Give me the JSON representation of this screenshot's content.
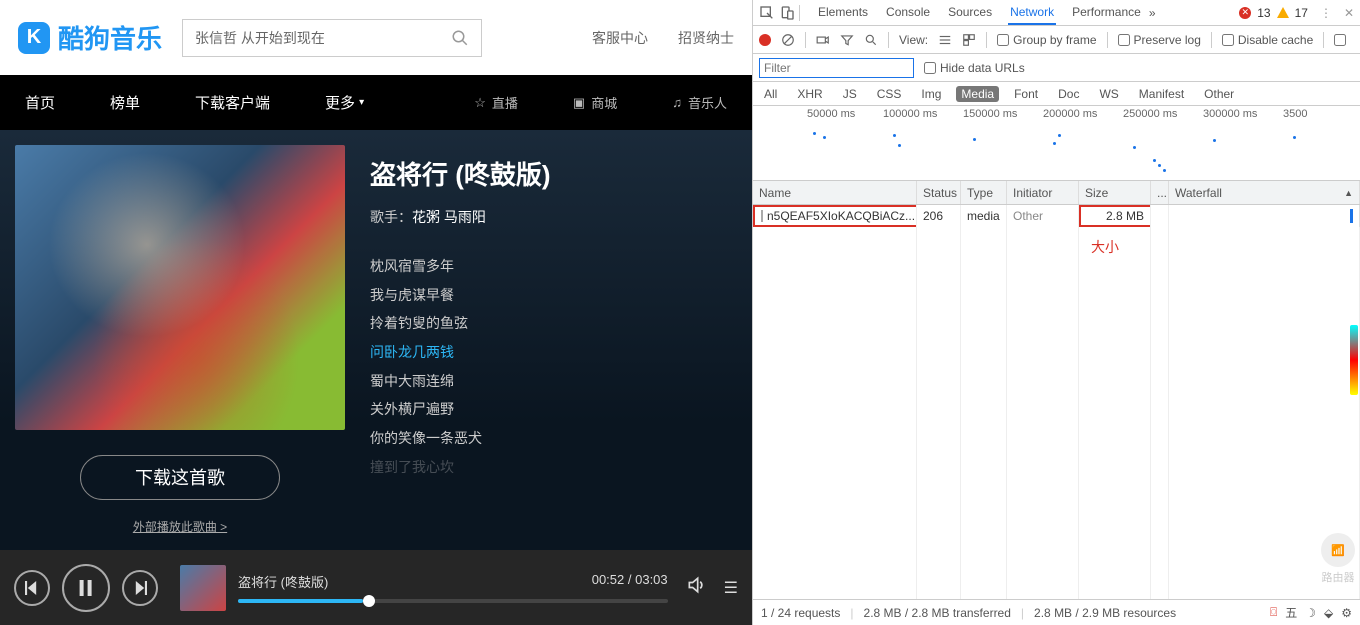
{
  "site": {
    "name": "酷狗音乐",
    "search_value": "张信哲 从开始到现在",
    "header_links": [
      "客服中心",
      "招贤纳士"
    ]
  },
  "nav": {
    "items": [
      "首页",
      "榜单",
      "下载客户端",
      "更多"
    ],
    "right": [
      {
        "icon": "star",
        "label": "直播"
      },
      {
        "icon": "cart",
        "label": "商城"
      },
      {
        "icon": "headphone",
        "label": "音乐人"
      }
    ]
  },
  "song": {
    "title": "盗将行 (咚鼓版)",
    "artist_label": "歌手：",
    "artist": "花粥 马雨阳",
    "lyrics": [
      "枕风宿雪多年",
      "我与虎谋早餐",
      "拎着钓叟的鱼弦",
      "问卧龙几两钱",
      "蜀中大雨连绵",
      "关外横尸遍野",
      "你的笑像一条恶犬",
      "撞到了我心坎"
    ],
    "active_lyric_index": 3,
    "download_btn": "下载这首歌",
    "external_link": "外部播放此歌曲 >"
  },
  "player": {
    "track": "盗将行 (咚鼓版)",
    "elapsed": "00:52",
    "duration": "03:03"
  },
  "devtools": {
    "tabs": [
      "Elements",
      "Console",
      "Sources",
      "Network",
      "Performance"
    ],
    "active_tab": "Network",
    "more": "»",
    "errors": "13",
    "warnings": "17",
    "toolbar": {
      "view_label": "View:",
      "group": "Group by frame",
      "preserve": "Preserve log",
      "disable_cache": "Disable cache"
    },
    "filter_placeholder": "Filter",
    "hide_data": "Hide data URLs",
    "type_filters": [
      "All",
      "XHR",
      "JS",
      "CSS",
      "Img",
      "Media",
      "Font",
      "Doc",
      "WS",
      "Manifest",
      "Other"
    ],
    "active_type_filter": "Media",
    "timeline_ticks": [
      "50000 ms",
      "100000 ms",
      "150000 ms",
      "200000 ms",
      "250000 ms",
      "300000 ms",
      "3500"
    ],
    "columns": [
      "Name",
      "Status",
      "Type",
      "Initiator",
      "Size",
      "...",
      "Waterfall"
    ],
    "rows": [
      {
        "name": "n5QEAF5XIoKACQBiACz...",
        "status": "206",
        "type": "media",
        "initiator": "Other",
        "size": "2.8 MB"
      }
    ],
    "size_annotation": "大小",
    "status_bar": {
      "requests": "1 / 24 requests",
      "transferred": "2.8 MB / 2.8 MB transferred",
      "resources": "2.8 MB / 2.9 MB resources"
    },
    "tray_label": "五",
    "logo_label": "路由器"
  }
}
